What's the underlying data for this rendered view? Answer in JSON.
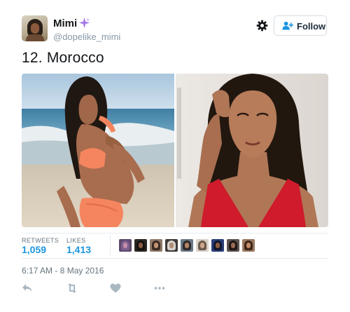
{
  "header": {
    "display_name": "Mimi",
    "handle": "@dopelike_mimi",
    "follow_label": "Follow",
    "icons": [
      "avatar",
      "sparkle-icon",
      "gear-icon",
      "add-user-icon"
    ]
  },
  "tweet": {
    "text": "12. Morocco",
    "media": [
      "photo",
      "photo"
    ]
  },
  "stats": {
    "retweets_label": "RETWEETS",
    "retweets_value": "1,059",
    "likes_label": "LIKES",
    "likes_value": "1,413",
    "liker_avatar_count": 9
  },
  "timestamp": "6:17 AM - 8 May 2016",
  "actions": [
    "reply-icon",
    "retweet-icon",
    "like-icon",
    "more-icon"
  ],
  "colors": {
    "link_blue": "#1b95e0",
    "muted_text": "#66757f",
    "handle_gray": "#8899a6",
    "divider": "#e6ecf0",
    "icon_gray": "#aab8c2",
    "sparkle_purple": "#a57be8",
    "swimsuit_coral": "#f4855f",
    "dress_red": "#cf1b2b"
  }
}
